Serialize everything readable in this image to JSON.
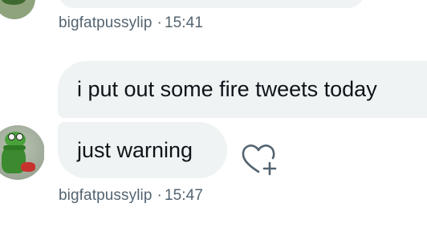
{
  "messages": [
    {
      "sender": "bigfatpussylip",
      "time": "15:41",
      "separator": "·"
    },
    {
      "sender": "bigfatpussylip",
      "time": "15:47",
      "separator": "·",
      "bubbles": [
        "i put out some fire tweets today",
        "just warning"
      ]
    }
  ],
  "icons": {
    "avatar": "kermit-avatar",
    "react": "heart-plus-icon"
  },
  "colors": {
    "bubble_bg": "#eff3f4",
    "meta_text": "#536471",
    "text": "#0f1419"
  }
}
